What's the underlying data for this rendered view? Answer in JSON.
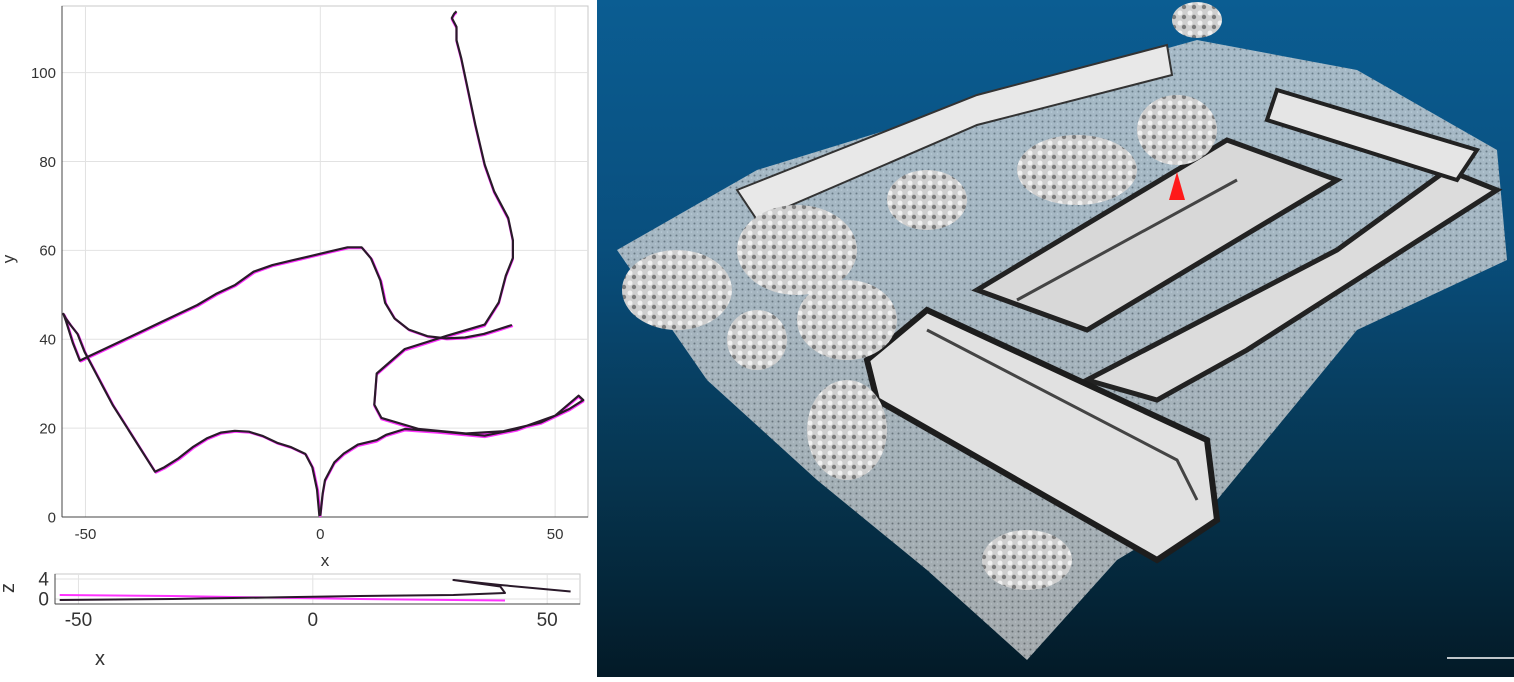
{
  "chart_data": [
    {
      "type": "line",
      "xlabel": "x",
      "ylabel": "y",
      "xlim": [
        -55,
        57
      ],
      "ylim": [
        0,
        115
      ],
      "x_ticks": [
        "-50",
        "0",
        "50"
      ],
      "y_ticks": [
        "0",
        "20",
        "40",
        "60",
        "80",
        "100"
      ],
      "grid": true,
      "series": [
        {
          "color": "#ff33ff",
          "x": [
            0,
            0.5,
            1,
            3,
            5,
            8,
            12,
            14,
            18,
            25,
            35,
            42,
            50,
            55,
            56,
            53,
            47,
            39,
            31,
            21,
            13,
            11.5,
            12,
            18,
            27,
            35,
            38,
            39.5,
            41,
            41,
            40,
            37,
            35,
            33,
            31,
            30,
            29,
            29,
            28,
            28.5,
            29
          ],
          "y": [
            0,
            5,
            8,
            12,
            14,
            16,
            17,
            18.2,
            19.5,
            19,
            18,
            19.5,
            22.5,
            27,
            26,
            24,
            21,
            19,
            18.5,
            19.5,
            22,
            25,
            32,
            37.5,
            40.5,
            43,
            48,
            54,
            58,
            62,
            67,
            73,
            79,
            88,
            98,
            103,
            107,
            110,
            112,
            113,
            113.5
          ]
        },
        {
          "color": "#ff33ff",
          "x": [
            0,
            -0.5,
            -1.5,
            -3,
            -6,
            -9,
            -12,
            -15,
            -18,
            -21,
            -24,
            -27,
            -30,
            -33,
            -35,
            -38,
            -41,
            -44,
            -46,
            -48,
            -50,
            -51.5,
            -53,
            -54,
            -54.5,
            -54,
            -52.5,
            -51,
            -49,
            -46,
            -42,
            -38,
            -34,
            -30,
            -26,
            -22,
            -18,
            -14,
            -10,
            -6,
            -2,
            2,
            6,
            9,
            11,
            13,
            14,
            16,
            19,
            23,
            27,
            31,
            35,
            38,
            41
          ],
          "y": [
            0,
            6,
            11,
            14,
            15.5,
            16.5,
            18,
            19,
            19.2,
            18.8,
            17.5,
            15.5,
            13,
            11,
            10,
            15,
            20,
            25,
            29,
            33,
            37,
            41,
            43,
            44.5,
            45.5,
            44,
            39,
            35,
            36,
            37.5,
            39.5,
            41.5,
            43.5,
            45.5,
            47.5,
            50,
            52,
            55,
            56.5,
            57.5,
            58.5,
            59.5,
            60.5,
            60.5,
            58,
            53,
            48,
            44.5,
            42,
            40.5,
            40,
            40.2,
            41,
            42,
            43
          ]
        },
        {
          "color": "#2a1a2a",
          "x": [
            0,
            0.5,
            1,
            3,
            5,
            8,
            12,
            14,
            18,
            25,
            35,
            42,
            50,
            55,
            56,
            53,
            47,
            39,
            31,
            21,
            13,
            11.5,
            12,
            18,
            27,
            35,
            38,
            39.5,
            41,
            41,
            40,
            37,
            35,
            33,
            31,
            30,
            29,
            29,
            28,
            28.5,
            29
          ],
          "y": [
            0.3,
            5.3,
            8.3,
            12.3,
            14.3,
            16.3,
            17.3,
            18.5,
            19.8,
            19.3,
            18.3,
            19.8,
            22.8,
            27.3,
            26.3,
            24.3,
            21.3,
            19.3,
            18.8,
            19.8,
            22.3,
            25.3,
            32.3,
            37.8,
            40.8,
            43.3,
            48.3,
            54.3,
            58.3,
            62.3,
            67.3,
            73.3,
            79.3,
            88.3,
            98.3,
            103.3,
            107.3,
            110.3,
            112.3,
            113.3,
            113.8
          ]
        },
        {
          "color": "#2a1a2a",
          "x": [
            -0.2,
            -0.7,
            -1.7,
            -3.2,
            -6.2,
            -9.2,
            -12.2,
            -15.2,
            -18.2,
            -21.2,
            -24.2,
            -27.2,
            -30.2,
            -33.2,
            -35.2,
            -38.2,
            -41.2,
            -44.2,
            -46.2,
            -48.2,
            -50.2,
            -51.7,
            -53.2,
            -54.2,
            -54.7,
            -54.2,
            -52.7,
            -51.2,
            -49.2,
            -46.2,
            -42.2,
            -38.2,
            -34.2,
            -30.2,
            -26.2,
            -22.2,
            -18.2,
            -14.2,
            -10.2,
            -6.2,
            -2.2,
            1.8,
            5.8,
            8.8,
            10.8,
            12.8,
            13.8,
            15.8,
            18.8,
            22.8,
            26.8,
            30.8,
            34.8,
            37.8,
            40.8
          ],
          "y": [
            0.2,
            6.2,
            11.2,
            14.2,
            15.7,
            16.7,
            18.2,
            19.2,
            19.4,
            19,
            17.7,
            15.7,
            13.2,
            11.2,
            10.2,
            15.2,
            20.2,
            25.2,
            29.2,
            33.2,
            37.2,
            41.2,
            43.2,
            44.7,
            45.7,
            44.2,
            39.2,
            35.2,
            36.2,
            37.7,
            39.7,
            41.7,
            43.7,
            45.7,
            47.7,
            50.2,
            52.2,
            55.2,
            56.7,
            57.7,
            58.7,
            59.7,
            60.7,
            60.7,
            58.2,
            53.2,
            48.2,
            44.7,
            42.2,
            40.7,
            40.2,
            40.4,
            41.2,
            42.2,
            43.2
          ]
        }
      ]
    },
    {
      "type": "line",
      "xlabel": "x",
      "ylabel": "z",
      "xlim": [
        -55,
        57
      ],
      "ylim": [
        -1,
        5
      ],
      "x_ticks": [
        "-50",
        "0",
        "50"
      ],
      "y_ticks": [
        "0",
        "4"
      ],
      "grid": true,
      "series": [
        {
          "color": "#ff33ff",
          "x": [
            -54,
            -30,
            -10,
            10,
            30,
            41
          ],
          "y": [
            0.8,
            0.6,
            0.3,
            0,
            -0.2,
            -0.3
          ]
        },
        {
          "color": "#2a1a2a",
          "x": [
            -54,
            -30,
            -10,
            10,
            30,
            41,
            40,
            30,
            40,
            55
          ],
          "y": [
            -0.2,
            0,
            0.3,
            0.6,
            0.8,
            1.2,
            2.5,
            3.8,
            2.8,
            1.5
          ]
        }
      ]
    }
  ],
  "pointcloud": {
    "marker_color": "#ff1a1a",
    "background_top": "#0b5d92",
    "background_bottom": "#031a27"
  }
}
